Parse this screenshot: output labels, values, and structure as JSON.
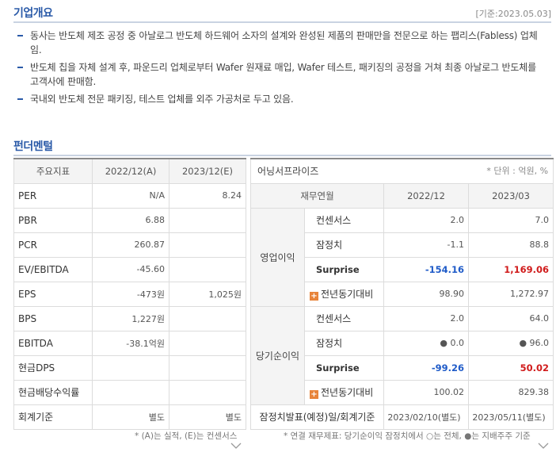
{
  "overview": {
    "title": "기업개요",
    "base_date": "[기준:2023.05.03]",
    "bullets": [
      "동사는 반도체 제조 공정 중 아날로그 반도체 하드웨어 소자의 설계와 완성된 제품의 판매만을 전문으로 하는 팹리스(Fabless) 업체임.",
      "반도체 칩을 자체 설계 후, 파운드리 업체로부터 Wafer 원재료 매입, Wafer 테스트, 패키징의 공정을 거쳐 최종 아날로그 반도체를 고객사에 판매함.",
      "국내외 반도체 전문 패키징, 테스트 업체를 외주 가공처로 두고 있음."
    ]
  },
  "fundamental": {
    "title": "펀더멘털",
    "left_table": {
      "headers": [
        "주요지표",
        "2022/12(A)",
        "2023/12(E)"
      ],
      "rows": [
        {
          "label": "PER",
          "a": "N/A",
          "e": "8.24"
        },
        {
          "label": "PBR",
          "a": "6.88",
          "e": ""
        },
        {
          "label": "PCR",
          "a": "260.87",
          "e": ""
        },
        {
          "label": "EV/EBITDA",
          "a": "-45.60",
          "e": ""
        },
        {
          "label": "EPS",
          "a": "-473원",
          "e": "1,025원"
        },
        {
          "label": "BPS",
          "a": "1,227원",
          "e": ""
        },
        {
          "label": "EBITDA",
          "a": "-38.1억원",
          "e": ""
        },
        {
          "label": "현금DPS",
          "a": "",
          "e": ""
        },
        {
          "label": "현금배당수익률",
          "a": "",
          "e": ""
        },
        {
          "label": "회계기준",
          "a": "별도",
          "e": "별도"
        }
      ],
      "note": "* (A)는 실적, (E)는 컨센서스"
    },
    "right_table": {
      "title": "어닝서프라이즈",
      "unit": "* 단위 : 억원, %",
      "headers": [
        "재무연월",
        "2022/12",
        "2023/03"
      ],
      "groups": [
        {
          "category": "영업이익",
          "rows": [
            {
              "label": "컨센서스",
              "v1": "2.0",
              "v2": "7.0"
            },
            {
              "label": "잠정치",
              "v1": "-1.1",
              "v2": "88.8"
            },
            {
              "label": "Surprise",
              "v1": "-154.16",
              "v2": "1,169.06"
            },
            {
              "label": "전년동기대비",
              "v1": "98.90",
              "v2": "1,272.97"
            }
          ]
        },
        {
          "category": "당기순이익",
          "rows": [
            {
              "label": "컨센서스",
              "v1": "2.0",
              "v2": "64.0"
            },
            {
              "label": "잠정치",
              "v1": "● 0.0",
              "v2": "● 96.0"
            },
            {
              "label": "Surprise",
              "v1": "-99.26",
              "v2": "50.02"
            },
            {
              "label": "전년동기대비",
              "v1": "100.02",
              "v2": "829.38"
            }
          ]
        }
      ],
      "footer": {
        "label": "잠정치발표(예정)일/회계기준",
        "v1": "2023/02/10(별도)",
        "v2": "2023/05/11(별도)"
      },
      "note": "* 연결 재무제표: 당기순이익 잠정치에서 ○는 전체, ●는 지배주주 기준"
    }
  },
  "colors": {
    "accent": "#2a5aa8",
    "positive": "#d01b1b",
    "negative": "#1f5bc8",
    "plus_icon": "#e8843a"
  },
  "icons": {
    "expand": "chevron-down-icon",
    "plus": "plus-icon"
  }
}
